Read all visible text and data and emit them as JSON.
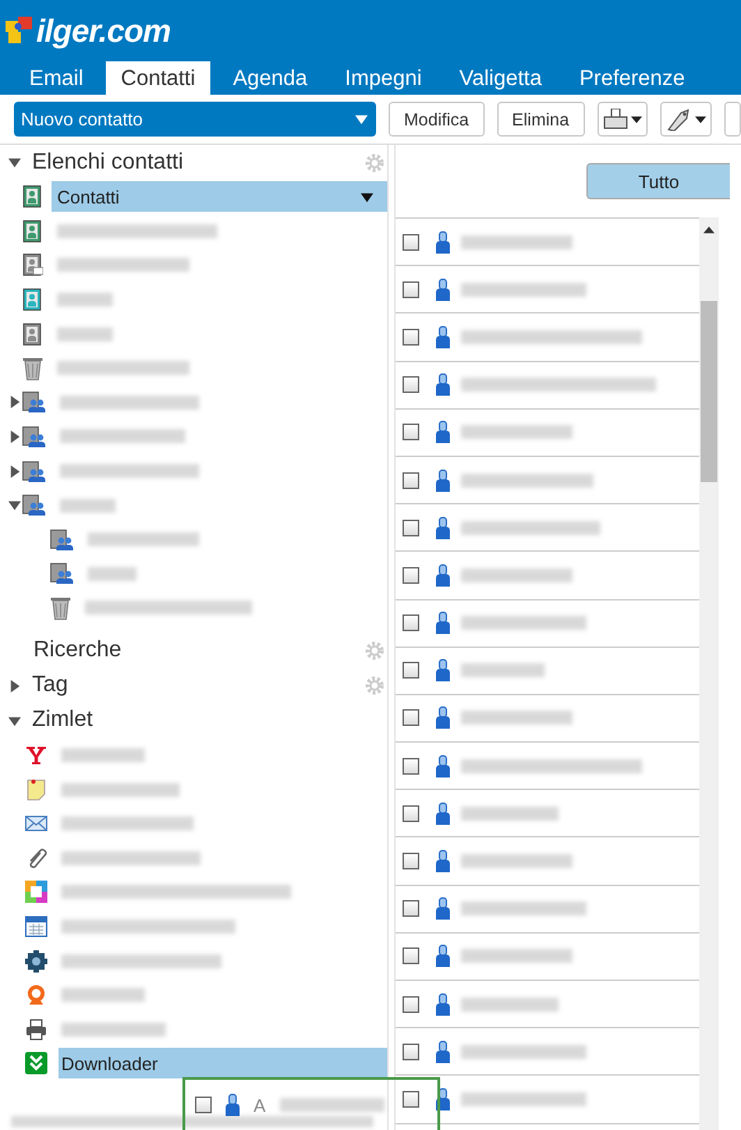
{
  "app": {
    "logo": "ilger.com"
  },
  "tabs": [
    {
      "label": "Email",
      "selected": false
    },
    {
      "label": "Contatti",
      "selected": true
    },
    {
      "label": "Agenda",
      "selected": false
    },
    {
      "label": "Impegni",
      "selected": false
    },
    {
      "label": "Valigetta",
      "selected": false
    },
    {
      "label": "Preferenze",
      "selected": false
    }
  ],
  "toolbar": {
    "new_button": "Nuovo contatto",
    "buttons": [
      "Modifica",
      "Elimina"
    ]
  },
  "address_books": {
    "title": "Elenchi contatti",
    "expanded": true,
    "items": [
      {
        "label": "Contatti",
        "kind": "personal",
        "selected": true
      },
      {
        "kind": "personal",
        "selected": false
      },
      {
        "kind": "emailed",
        "selected": false
      },
      {
        "kind": "shared",
        "selected": false
      },
      {
        "kind": "distribution",
        "selected": false
      },
      {
        "kind": "trash",
        "selected": false
      },
      {
        "kind": "group",
        "selected": false,
        "expanded": false
      },
      {
        "kind": "group",
        "selected": false,
        "expanded": false
      },
      {
        "kind": "group",
        "selected": false,
        "expanded": false
      },
      {
        "kind": "group",
        "selected": false,
        "expanded": true,
        "children": [
          {
            "kind": "subgroup",
            "selected": false
          },
          {
            "kind": "subgroup",
            "selected": false
          },
          {
            "kind": "trash",
            "selected": false
          }
        ]
      }
    ]
  },
  "searches": {
    "title": "Ricerche"
  },
  "tags": {
    "title": "Tag",
    "expanded": false
  },
  "zimlets": {
    "title": "Zimlet",
    "expanded": true,
    "items": [
      {
        "kind": "yahoo",
        "selected": false
      },
      {
        "kind": "note",
        "selected": false
      },
      {
        "kind": "mail",
        "selected": false
      },
      {
        "kind": "clip",
        "selected": false
      },
      {
        "kind": "frame",
        "selected": false
      },
      {
        "kind": "calendar",
        "selected": false
      },
      {
        "kind": "gear",
        "selected": false
      },
      {
        "kind": "webcam",
        "selected": false
      },
      {
        "kind": "print",
        "selected": false
      },
      {
        "label": "Downloader",
        "kind": "download",
        "selected": true
      }
    ]
  },
  "contact_list": {
    "filter": {
      "label": "Tutto",
      "selected": true
    },
    "rows": [
      {
        "checked": false
      },
      {
        "checked": false
      },
      {
        "checked": false
      },
      {
        "checked": false
      },
      {
        "checked": false
      },
      {
        "checked": false
      },
      {
        "checked": false
      },
      {
        "checked": false
      },
      {
        "checked": false
      },
      {
        "checked": false
      },
      {
        "checked": false
      },
      {
        "checked": false
      },
      {
        "checked": false
      },
      {
        "checked": false
      },
      {
        "checked": false
      },
      {
        "checked": false
      },
      {
        "checked": false
      },
      {
        "checked": false
      },
      {
        "checked": false
      }
    ]
  },
  "drag_proxy": {
    "label": "A",
    "checked": false
  }
}
